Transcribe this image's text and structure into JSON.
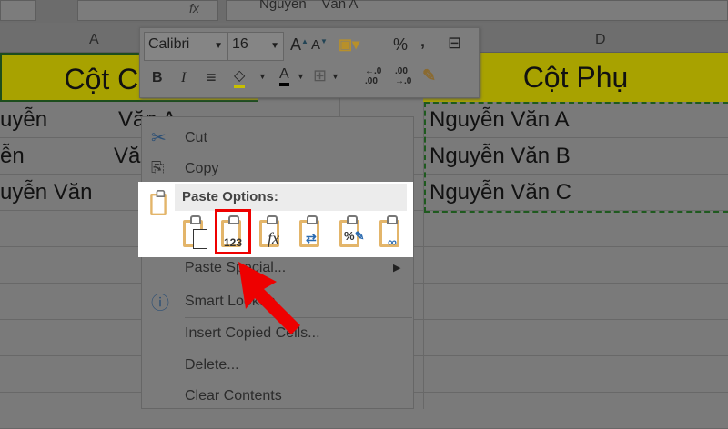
{
  "formula_bar": {
    "content": "Nguyễn    Văn A",
    "fx": "fx"
  },
  "columns": {
    "a": "A",
    "d": "D"
  },
  "sheet": {
    "header_a": "Cột Chính",
    "header_d": "Cột Phụ",
    "col_a": [
      {
        "first": "uyễn",
        "second": "Văn A"
      },
      {
        "first": "ễn",
        "second": "Văn B"
      },
      {
        "first": "uyễn Văn",
        "second": ""
      }
    ],
    "col_d": [
      "Nguyễn Văn A",
      "Nguyễn Văn B",
      "Nguyễn Văn C"
    ]
  },
  "mini_toolbar": {
    "font": "Calibri",
    "size": "16",
    "bold": "B",
    "italic": "I",
    "percent": "%",
    "comma": ",",
    "inc_dec": "←.0 .00",
    "dec_dec": ".00 →.0",
    "fill_color": "#c8c000",
    "font_color": "#000000"
  },
  "context_menu": {
    "cut": "Cut",
    "copy": "Copy",
    "paste_options": "Paste Options:",
    "paste_icons": [
      "paste",
      "values-123",
      "formulas-fx",
      "transpose",
      "formatting",
      "paste-link"
    ],
    "values_label": "123",
    "fx_label": "fx",
    "paste_special": "Paste Special...",
    "smart_lookup": "Smart Lookup",
    "insert_copied": "Insert Copied Cells...",
    "delete": "Delete...",
    "clear": "Clear Contents"
  },
  "highlight_color": "#ee0000"
}
